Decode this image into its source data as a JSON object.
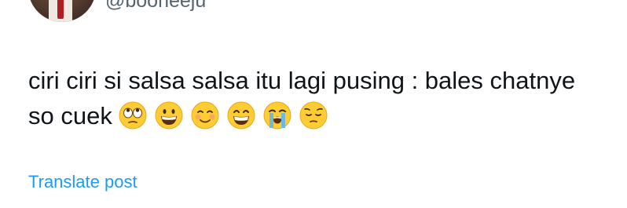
{
  "tweet": {
    "handle": "@booneeju",
    "text_line1": "ciri ciri si salsa salsa itu lagi pusing : bales chatnye",
    "text_line2": "so cuek",
    "emojis": [
      "rolling-eyes-icon",
      "grinning-face-icon",
      "smiling-face-icon",
      "beaming-face-icon",
      "crying-face-icon",
      "pensive-face-icon"
    ],
    "translate_label": "Translate post"
  },
  "colors": {
    "text": "#0f1419",
    "secondary": "#536471",
    "link": "#1d9bf0",
    "emoji_yellow": "#ffcc33"
  }
}
